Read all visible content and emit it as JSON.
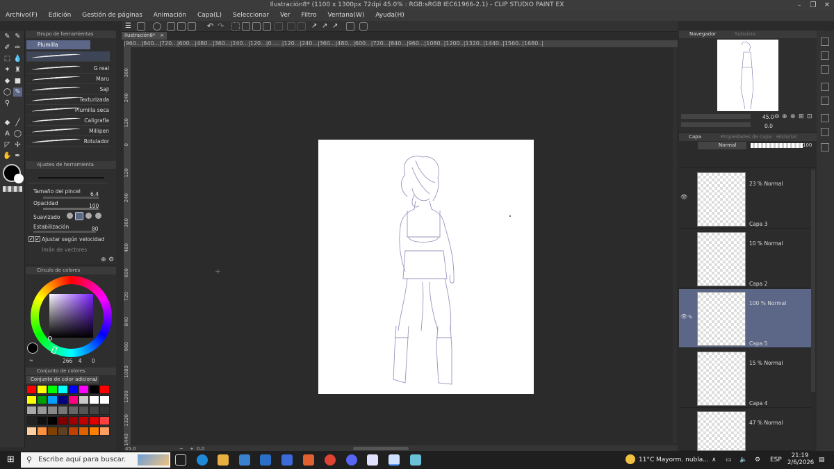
{
  "window": {
    "title": "Ilustración8* (1100 x 1300px 72dpi 45.0% : RGB:sRGB IEC61966-2.1) - CLIP STUDIO PAINT EX"
  },
  "menu": [
    "Archivo(F)",
    "Edición",
    "Gestión de páginas",
    "Animación",
    "Capa(L)",
    "Seleccionar",
    "Ver",
    "Filtro",
    "Ventana(W)",
    "Ayuda(H)"
  ],
  "document_tab": {
    "label": "Ilustración8*",
    "close": "×"
  },
  "subtool_panel": {
    "title": "Grupo de herramientas",
    "selected_group": "Plumilla",
    "brushes": [
      "",
      "G real",
      "Maru",
      "Saji",
      "Texturizada",
      "Plumilla seca",
      "Caligrafía",
      "Millipen",
      "Rotulador"
    ]
  },
  "tool_settings": {
    "title": "Ajustes de herramienta",
    "brush_size_label": "Tamaño del pincel",
    "brush_size_value": "6.4",
    "opacity_label": "Opacidad",
    "opacity_value": "100",
    "smoothing_label": "Suavizado",
    "stabilization_label": "Estabilización",
    "stabilization_value": "80",
    "speed_adjust_label": "Ajustar según velocidad",
    "vector_magnet_label": "Imán de vectores"
  },
  "color_wheel": {
    "title": "Círculo de colores",
    "h_value": "266",
    "s_value": "4",
    "v_value": "0"
  },
  "color_set": {
    "title": "Conjunto de colores",
    "dropdown": "Conjunto de color adicional",
    "swatches": [
      "#ff0000",
      "#ffff00",
      "#00ff00",
      "#00ffff",
      "#0000ff",
      "#ff00ff",
      "#000000",
      "#ff0000",
      "#ffff00",
      "#00a000",
      "#00a0ff",
      "#000080",
      "#ff0080",
      "#cccccc",
      "#ffffff",
      "#ffffff",
      "#aaaaaa",
      "#999999",
      "#888888",
      "#777777",
      "#666666",
      "#555555",
      "#444444",
      "#333333",
      "#222222",
      "#111111",
      "#000000",
      "#800000",
      "#a00000",
      "#c00000",
      "#e00000",
      "#ff4040",
      "#ffd0a0",
      "#ff9040",
      "#804000",
      "#604020",
      "#c04000",
      "#e06000",
      "#ff8000",
      "#ffa060"
    ]
  },
  "navigator": {
    "tab_active": "Navegador",
    "tab_inactive": "Subvista",
    "zoom": "45.0",
    "rotation": "0.0"
  },
  "layer_panel": {
    "tabs": [
      "Capa",
      "Propiedades de capa",
      "Historial"
    ],
    "blend_mode": "Normal",
    "opacity": "100",
    "layers": [
      {
        "mode": "23 % Normal",
        "name": "Capa 3",
        "visible": true,
        "selected": false
      },
      {
        "mode": "10 % Normal",
        "name": "Capa 2",
        "visible": false,
        "selected": false
      },
      {
        "mode": "100 % Normal",
        "name": "Capa 5",
        "visible": true,
        "selected": true
      },
      {
        "mode": "15 % Normal",
        "name": "Capa 4",
        "visible": false,
        "selected": false
      },
      {
        "mode": "47 % Normal",
        "name": "",
        "visible": false,
        "selected": false
      }
    ]
  },
  "ruler_top": "|960...|840...|720...|600...|480...|360...|240...|120...|0......|120...|240...|360...|480...|600...|720...|840...|960...|1080..|1200..|1320..|1440..|1560..|1680..|",
  "ruler_left": [
    "360",
    "240",
    "120",
    "0",
    "120",
    "240",
    "360",
    "480",
    "600",
    "720",
    "840",
    "960",
    "1080",
    "1200",
    "1320",
    "1440"
  ],
  "status": {
    "zoom": "45.0",
    "angle": "0.0"
  },
  "taskbar": {
    "search_placeholder": "Escribe aquí para buscar.",
    "weather_temp": "11°C",
    "weather_desc": "Mayorm. nubla...",
    "language": "ESP",
    "time": "21:19",
    "date": "2/6/2026"
  },
  "colors": {
    "accent_selected_layer": "#5c6788",
    "panel_bg": "#2e2e2e",
    "canvas_bg": "#2b2b2b"
  }
}
